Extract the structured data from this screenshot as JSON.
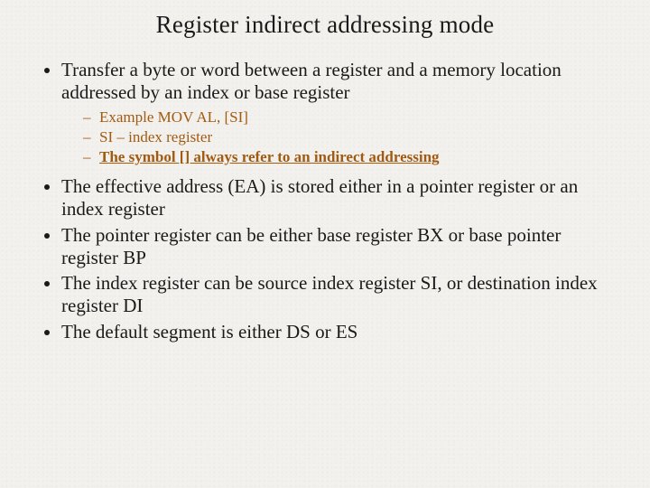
{
  "title": "Register indirect addressing mode",
  "b1": "Transfer a byte or word between a register and a memory location addressed by an index or base register",
  "sub1": "Example MOV AL, [SI]",
  "sub2": "SI – index register",
  "sub3": "The symbol [] always refer to an indirect addressing",
  "b2": "The effective address (EA) is stored either in a pointer register or an index register",
  "b3": "The pointer register can be either base register BX or base pointer register BP",
  "b4": "The index register can be source index register SI, or destination index register DI",
  "b5": "The default segment is either DS or ES"
}
